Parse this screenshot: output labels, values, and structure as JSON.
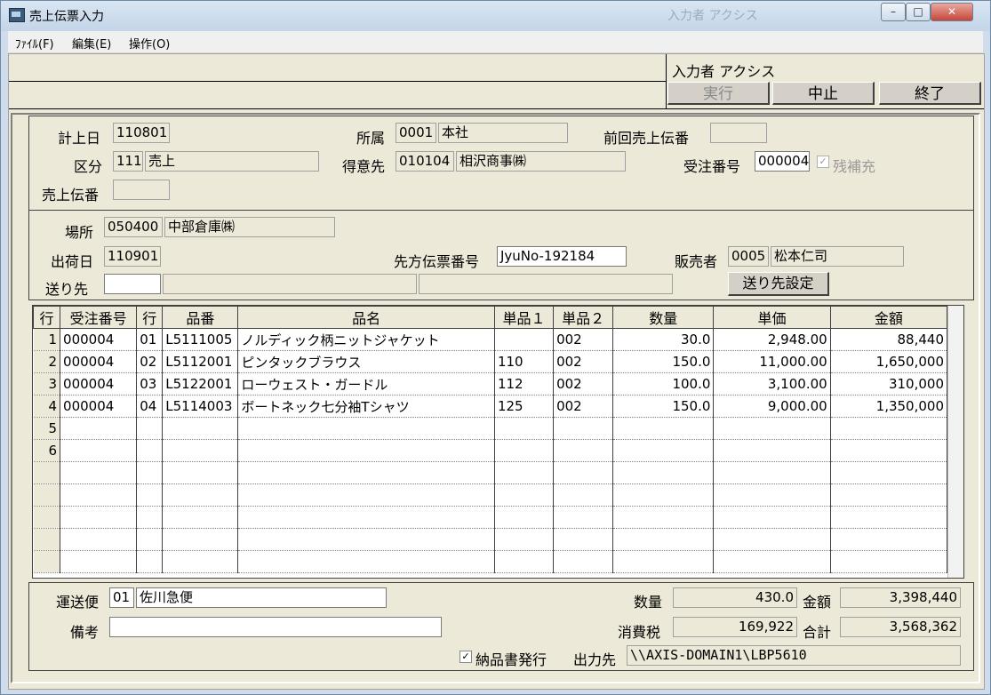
{
  "window": {
    "title": "売上伝票入力",
    "ghost_title": "入力者 アクシス"
  },
  "menu": [
    {
      "label": "ﾌｧｲﾙ(F)"
    },
    {
      "label": "編集(E)"
    },
    {
      "label": "操作(O)"
    }
  ],
  "toolbar": {
    "inputter": "入力者 アクシス",
    "execute": "実行",
    "cancel": "中止",
    "close": "終了"
  },
  "header": {
    "date_label": "計上日",
    "date": "110801",
    "division_label": "区分",
    "division_code": "111",
    "division_name": "売上",
    "slip_label": "売上伝番",
    "slip": "",
    "dept_label": "所属",
    "dept_code": "0001",
    "dept_name": "本社",
    "customer_label": "得意先",
    "customer_code": "010104",
    "customer_name": "相沢商事㈱",
    "prev_label": "前回売上伝番",
    "prev": "",
    "order_label": "受注番号",
    "order_no": "000004",
    "remain_label": "残補充"
  },
  "ship": {
    "place_label": "場所",
    "place_code": "050400",
    "place_name": "中部倉庫㈱",
    "date_label": "出荷日",
    "date": "110901",
    "dest_label": "送り先",
    "dest_code": "",
    "dest_name": "",
    "dest_addr": "",
    "remote_label": "先方伝票番号",
    "remote_no": "JyuNo-192184",
    "seller_label": "販売者",
    "seller_code": "0005",
    "seller_name": "松本仁司",
    "dest_button": "送り先設定"
  },
  "table": {
    "headers": [
      "行",
      "受注番号",
      "行",
      "品番",
      "品名",
      "単品１",
      "単品２",
      "数量",
      "単価",
      "金額"
    ],
    "rows": [
      [
        "1",
        "000004",
        "01",
        "L5111005",
        "ノルディック柄ニットジャケット",
        "",
        "002",
        "30.0",
        "2,948.00",
        "88,440"
      ],
      [
        "2",
        "000004",
        "02",
        "L5112001",
        "ピンタックブラウス",
        "110",
        "002",
        "150.0",
        "11,000.00",
        "1,650,000"
      ],
      [
        "3",
        "000004",
        "03",
        "L5122001",
        "ローウェスト・ガードル",
        "112",
        "002",
        "100.0",
        "3,100.00",
        "310,000"
      ],
      [
        "4",
        "000004",
        "04",
        "L5114003",
        "ボートネック七分袖Tシャツ",
        "125",
        "002",
        "150.0",
        "9,000.00",
        "1,350,000"
      ],
      [
        "5",
        "",
        "",
        "",
        "",
        "",
        "",
        "",
        "",
        ""
      ],
      [
        "6",
        "",
        "",
        "",
        "",
        "",
        "",
        "",
        "",
        ""
      ],
      [
        "",
        "",
        "",
        "",
        "",
        "",
        "",
        "",
        "",
        ""
      ],
      [
        "",
        "",
        "",
        "",
        "",
        "",
        "",
        "",
        "",
        ""
      ],
      [
        "",
        "",
        "",
        "",
        "",
        "",
        "",
        "",
        "",
        ""
      ],
      [
        "",
        "",
        "",
        "",
        "",
        "",
        "",
        "",
        "",
        ""
      ],
      [
        "",
        "",
        "",
        "",
        "",
        "",
        "",
        "",
        "",
        ""
      ]
    ]
  },
  "footer": {
    "carrier_label": "運送便",
    "carrier_code": "01",
    "carrier_name": "佐川急便",
    "memo_label": "備考",
    "memo": "",
    "qty_label": "数量",
    "qty": "430.0",
    "amount_label": "金額",
    "amount": "3,398,440",
    "tax_label": "消費税",
    "tax": "169,922",
    "total_label": "合計",
    "total": "3,568,362",
    "delivery_label": "納品書発行",
    "output_label": "出力先",
    "output": "\\\\AXIS-DOMAIN1\\LBP5610"
  }
}
